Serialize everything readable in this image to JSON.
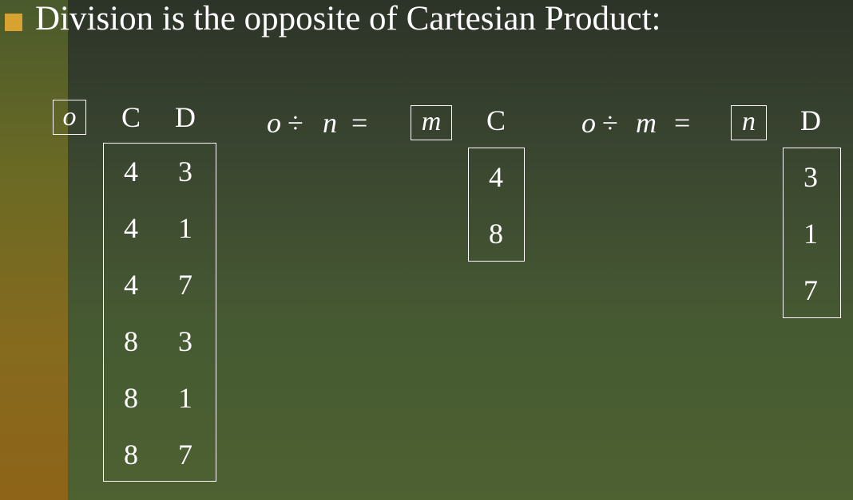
{
  "heading": "Division is the opposite of Cartesian Product:",
  "relation_o": {
    "name": "o",
    "columns": [
      "C",
      "D"
    ],
    "rows": [
      [
        "4",
        "3"
      ],
      [
        "4",
        "1"
      ],
      [
        "4",
        "7"
      ],
      [
        "8",
        "3"
      ],
      [
        "8",
        "1"
      ],
      [
        "8",
        "7"
      ]
    ]
  },
  "eq1": {
    "left": "o",
    "op": "÷",
    "right": "n",
    "equals": "=",
    "result": "m",
    "column": "C",
    "rows": [
      "4",
      "8"
    ]
  },
  "eq2": {
    "left": "o",
    "op": "÷",
    "right": "m",
    "equals": "=",
    "result": "n",
    "column": "D",
    "rows": [
      "3",
      "1",
      "7"
    ]
  }
}
